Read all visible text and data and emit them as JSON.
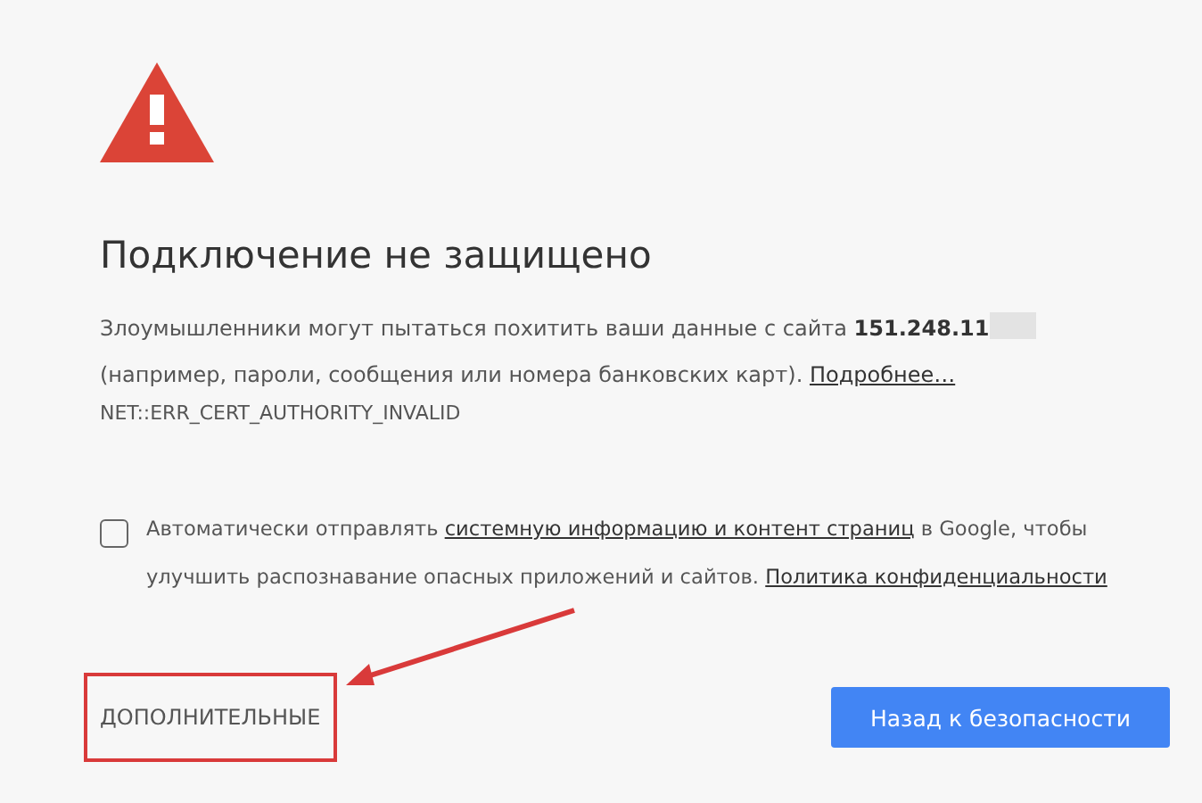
{
  "heading": "Подключение не защищено",
  "description": {
    "text": "Злоумышленники могут пытаться похитить ваши данные с сайта",
    "host": "151.248.11",
    "redacted": true,
    "text_2": "(например, пароли, сообщения или номера банковских карт).",
    "link": "Подробнее…"
  },
  "error_code": "NET::ERR_CERT_AUTHORITY_INVALID",
  "report": {
    "checked": false,
    "text": "Автоматически отправлять",
    "link": "системную информацию и контент страниц",
    "text_2": "в Google, чтобы улучшить распознавание опасных приложений и сайтов.",
    "link_2": "Политика конфиденциальности"
  },
  "buttons": [
    {
      "kind": "flat",
      "label": "ДОПОЛНИТЕЛЬНЫЕ"
    },
    {
      "kind": "primary",
      "label": "Назад к безопасности"
    }
  ]
}
